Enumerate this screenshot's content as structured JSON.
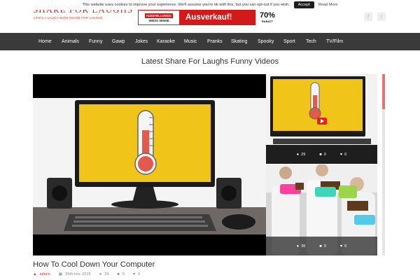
{
  "cookie": {
    "message": "This website uses cookies to improve your experience. We'll assume you're ok with this, but you can opt-out if you wish.",
    "accept_label": "Accept",
    "read_more_label": "Read More"
  },
  "header": {
    "logo": "SHARE FOR LAUGHS",
    "tagline": "LIFE'S A LAUGH WITH SHARE FOR LAUGHS"
  },
  "ad": {
    "left_line1": "AUSSTELLUNGS-",
    "left_line2": "SWISS SENSE",
    "headline": "Ausverkauf!",
    "percent": "70%",
    "badge_text": "RABATT"
  },
  "social": {
    "facebook_icon": "f",
    "twitter_icon": "t"
  },
  "nav": {
    "items": [
      "Home",
      "Animals",
      "Funny",
      "Gawp",
      "Jokes",
      "Karaoke",
      "Music",
      "Pranks",
      "Skating",
      "Spooky",
      "Sport",
      "Tech",
      "TV/Film"
    ]
  },
  "section": {
    "title": "Latest Share For Laughs Funny Videos"
  },
  "thumbs": [
    {
      "views": "29",
      "comments": "0",
      "likes": "0"
    },
    {
      "views": "36",
      "comments": "0",
      "likes": "0"
    }
  ],
  "post": {
    "title": "How To Cool Down Your Computer",
    "author": "admin",
    "date": "26th nov, 2015",
    "views": "29",
    "comments": "0",
    "likes": "0"
  },
  "colors": {
    "accent": "#c0392b",
    "nav_bg": "#3a3a3a",
    "screen_yellow": "#f0c419"
  }
}
